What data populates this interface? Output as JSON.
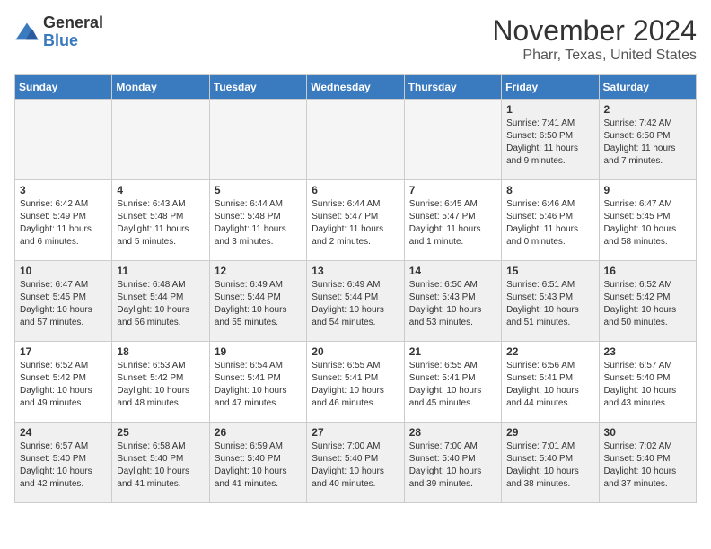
{
  "logo": {
    "general": "General",
    "blue": "Blue"
  },
  "header": {
    "month": "November 2024",
    "location": "Pharr, Texas, United States"
  },
  "days_of_week": [
    "Sunday",
    "Monday",
    "Tuesday",
    "Wednesday",
    "Thursday",
    "Friday",
    "Saturday"
  ],
  "weeks": [
    [
      {
        "day": "",
        "info": "",
        "empty": true
      },
      {
        "day": "",
        "info": "",
        "empty": true
      },
      {
        "day": "",
        "info": "",
        "empty": true
      },
      {
        "day": "",
        "info": "",
        "empty": true
      },
      {
        "day": "",
        "info": "",
        "empty": true
      },
      {
        "day": "1",
        "info": "Sunrise: 7:41 AM\nSunset: 6:50 PM\nDaylight: 11 hours and 9 minutes."
      },
      {
        "day": "2",
        "info": "Sunrise: 7:42 AM\nSunset: 6:50 PM\nDaylight: 11 hours and 7 minutes."
      }
    ],
    [
      {
        "day": "3",
        "info": "Sunrise: 6:42 AM\nSunset: 5:49 PM\nDaylight: 11 hours and 6 minutes."
      },
      {
        "day": "4",
        "info": "Sunrise: 6:43 AM\nSunset: 5:48 PM\nDaylight: 11 hours and 5 minutes."
      },
      {
        "day": "5",
        "info": "Sunrise: 6:44 AM\nSunset: 5:48 PM\nDaylight: 11 hours and 3 minutes."
      },
      {
        "day": "6",
        "info": "Sunrise: 6:44 AM\nSunset: 5:47 PM\nDaylight: 11 hours and 2 minutes."
      },
      {
        "day": "7",
        "info": "Sunrise: 6:45 AM\nSunset: 5:47 PM\nDaylight: 11 hours and 1 minute."
      },
      {
        "day": "8",
        "info": "Sunrise: 6:46 AM\nSunset: 5:46 PM\nDaylight: 11 hours and 0 minutes."
      },
      {
        "day": "9",
        "info": "Sunrise: 6:47 AM\nSunset: 5:45 PM\nDaylight: 10 hours and 58 minutes."
      }
    ],
    [
      {
        "day": "10",
        "info": "Sunrise: 6:47 AM\nSunset: 5:45 PM\nDaylight: 10 hours and 57 minutes."
      },
      {
        "day": "11",
        "info": "Sunrise: 6:48 AM\nSunset: 5:44 PM\nDaylight: 10 hours and 56 minutes."
      },
      {
        "day": "12",
        "info": "Sunrise: 6:49 AM\nSunset: 5:44 PM\nDaylight: 10 hours and 55 minutes."
      },
      {
        "day": "13",
        "info": "Sunrise: 6:49 AM\nSunset: 5:44 PM\nDaylight: 10 hours and 54 minutes."
      },
      {
        "day": "14",
        "info": "Sunrise: 6:50 AM\nSunset: 5:43 PM\nDaylight: 10 hours and 53 minutes."
      },
      {
        "day": "15",
        "info": "Sunrise: 6:51 AM\nSunset: 5:43 PM\nDaylight: 10 hours and 51 minutes."
      },
      {
        "day": "16",
        "info": "Sunrise: 6:52 AM\nSunset: 5:42 PM\nDaylight: 10 hours and 50 minutes."
      }
    ],
    [
      {
        "day": "17",
        "info": "Sunrise: 6:52 AM\nSunset: 5:42 PM\nDaylight: 10 hours and 49 minutes."
      },
      {
        "day": "18",
        "info": "Sunrise: 6:53 AM\nSunset: 5:42 PM\nDaylight: 10 hours and 48 minutes."
      },
      {
        "day": "19",
        "info": "Sunrise: 6:54 AM\nSunset: 5:41 PM\nDaylight: 10 hours and 47 minutes."
      },
      {
        "day": "20",
        "info": "Sunrise: 6:55 AM\nSunset: 5:41 PM\nDaylight: 10 hours and 46 minutes."
      },
      {
        "day": "21",
        "info": "Sunrise: 6:55 AM\nSunset: 5:41 PM\nDaylight: 10 hours and 45 minutes."
      },
      {
        "day": "22",
        "info": "Sunrise: 6:56 AM\nSunset: 5:41 PM\nDaylight: 10 hours and 44 minutes."
      },
      {
        "day": "23",
        "info": "Sunrise: 6:57 AM\nSunset: 5:40 PM\nDaylight: 10 hours and 43 minutes."
      }
    ],
    [
      {
        "day": "24",
        "info": "Sunrise: 6:57 AM\nSunset: 5:40 PM\nDaylight: 10 hours and 42 minutes."
      },
      {
        "day": "25",
        "info": "Sunrise: 6:58 AM\nSunset: 5:40 PM\nDaylight: 10 hours and 41 minutes."
      },
      {
        "day": "26",
        "info": "Sunrise: 6:59 AM\nSunset: 5:40 PM\nDaylight: 10 hours and 41 minutes."
      },
      {
        "day": "27",
        "info": "Sunrise: 7:00 AM\nSunset: 5:40 PM\nDaylight: 10 hours and 40 minutes."
      },
      {
        "day": "28",
        "info": "Sunrise: 7:00 AM\nSunset: 5:40 PM\nDaylight: 10 hours and 39 minutes."
      },
      {
        "day": "29",
        "info": "Sunrise: 7:01 AM\nSunset: 5:40 PM\nDaylight: 10 hours and 38 minutes."
      },
      {
        "day": "30",
        "info": "Sunrise: 7:02 AM\nSunset: 5:40 PM\nDaylight: 10 hours and 37 minutes."
      }
    ]
  ]
}
